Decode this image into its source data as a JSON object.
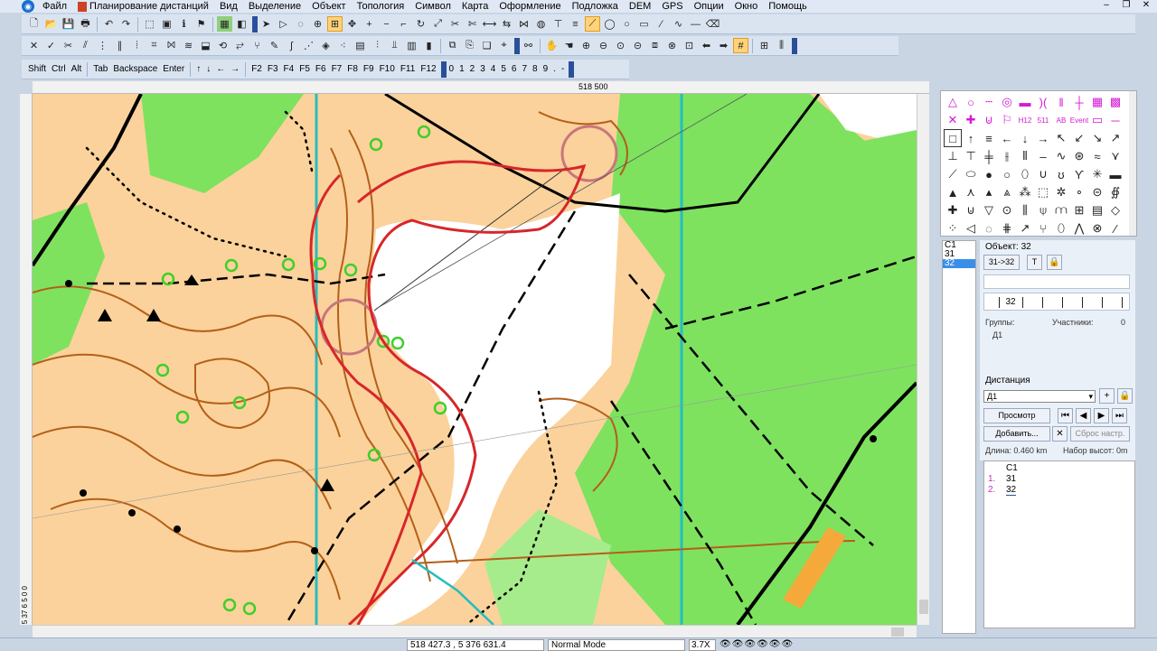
{
  "menu": [
    "Файл",
    "Планирование дистанций",
    "Вид",
    "Выделение",
    "Объект",
    "Топология",
    "Символ",
    "Карта",
    "Оформление",
    "Подложка",
    "DEM",
    "GPS",
    "Опции",
    "Окно",
    "Помощь"
  ],
  "window_buttons": [
    "–",
    "❐",
    "✕"
  ],
  "keys": [
    "Shift",
    "Ctrl",
    "Alt",
    "Tab",
    "Backspace",
    "Enter"
  ],
  "arrow_keys": [
    "↑",
    "↓",
    "←",
    "→"
  ],
  "fkeys": [
    "F2",
    "F3",
    "F4",
    "F5",
    "F6",
    "F7",
    "F8",
    "F9",
    "F10",
    "F11",
    "F12"
  ],
  "digits": [
    "0",
    "1",
    "2",
    "3",
    "4",
    "5",
    "6",
    "7",
    "8",
    "9",
    ".",
    "-"
  ],
  "ruler": {
    "top_label": "518 500",
    "left_label": "5 37 6 5 0 0"
  },
  "symbols_panel": {
    "text_symbols": [
      "H12",
      "511",
      "AB",
      "Event"
    ]
  },
  "list": {
    "items": [
      "C1",
      "31",
      "32"
    ],
    "selected": "32"
  },
  "object": {
    "title": "Объект: 32",
    "btn_31_32": "31->32",
    "btn_t": "T",
    "code": "32",
    "groups_label": "Группы:",
    "participants_label": "Участники:",
    "participants_count": "0",
    "group_value": "Д1"
  },
  "distance": {
    "title": "Дистанция",
    "selected": "Д1",
    "view_btn": "Просмотр",
    "add_btn": "Добавить...",
    "reset_btn": "Сброс настр.",
    "length": "Длина: 0.460 km",
    "climb": "Набор высот: 0m"
  },
  "course": [
    {
      "num": "",
      "code": "C1"
    },
    {
      "num": "1.",
      "code": "31"
    },
    {
      "num": "2.",
      "code": "32"
    }
  ],
  "status": {
    "coords": "518 427.3 , 5 376 631.4",
    "mode": "Normal Mode",
    "zoom": "3.7X",
    "eyes": "👁👁👁👁👁👁"
  },
  "colors": {
    "forest": "#7ee25f",
    "open": "#fbd29b",
    "contour": "#b45f19",
    "course": "#d7262a",
    "water_line": "#25bdbf",
    "green_ring": "#3fcf2b"
  }
}
